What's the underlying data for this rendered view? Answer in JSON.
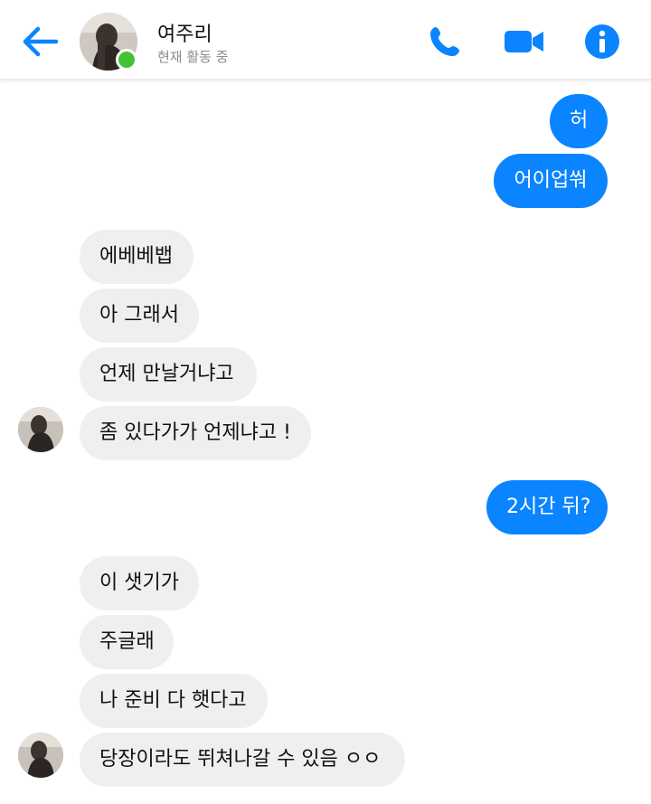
{
  "header": {
    "contact_name": "여주리",
    "status": "현재 활동 중"
  },
  "colors": {
    "accent": "#0a84ff",
    "incoming_bubble": "#efefef",
    "online": "#44c234"
  },
  "messages": [
    {
      "direction": "out",
      "text": "허"
    },
    {
      "direction": "out",
      "text": "어이업쒀"
    },
    {
      "direction": "in",
      "text": "에베베뱁"
    },
    {
      "direction": "in",
      "text": "아 그래서"
    },
    {
      "direction": "in",
      "text": "언제 만날거냐고"
    },
    {
      "direction": "in",
      "text": "좀 있다가가 언제냐고 !"
    },
    {
      "direction": "out",
      "text": "2시간 뒤?"
    },
    {
      "direction": "in",
      "text": "이 샛기가"
    },
    {
      "direction": "in",
      "text": "주글래"
    },
    {
      "direction": "in",
      "text": "나 준비 다 햇다고"
    },
    {
      "direction": "in",
      "text": "당장이라도 뛰쳐나갈 수 있음 ㅇㅇ"
    }
  ]
}
